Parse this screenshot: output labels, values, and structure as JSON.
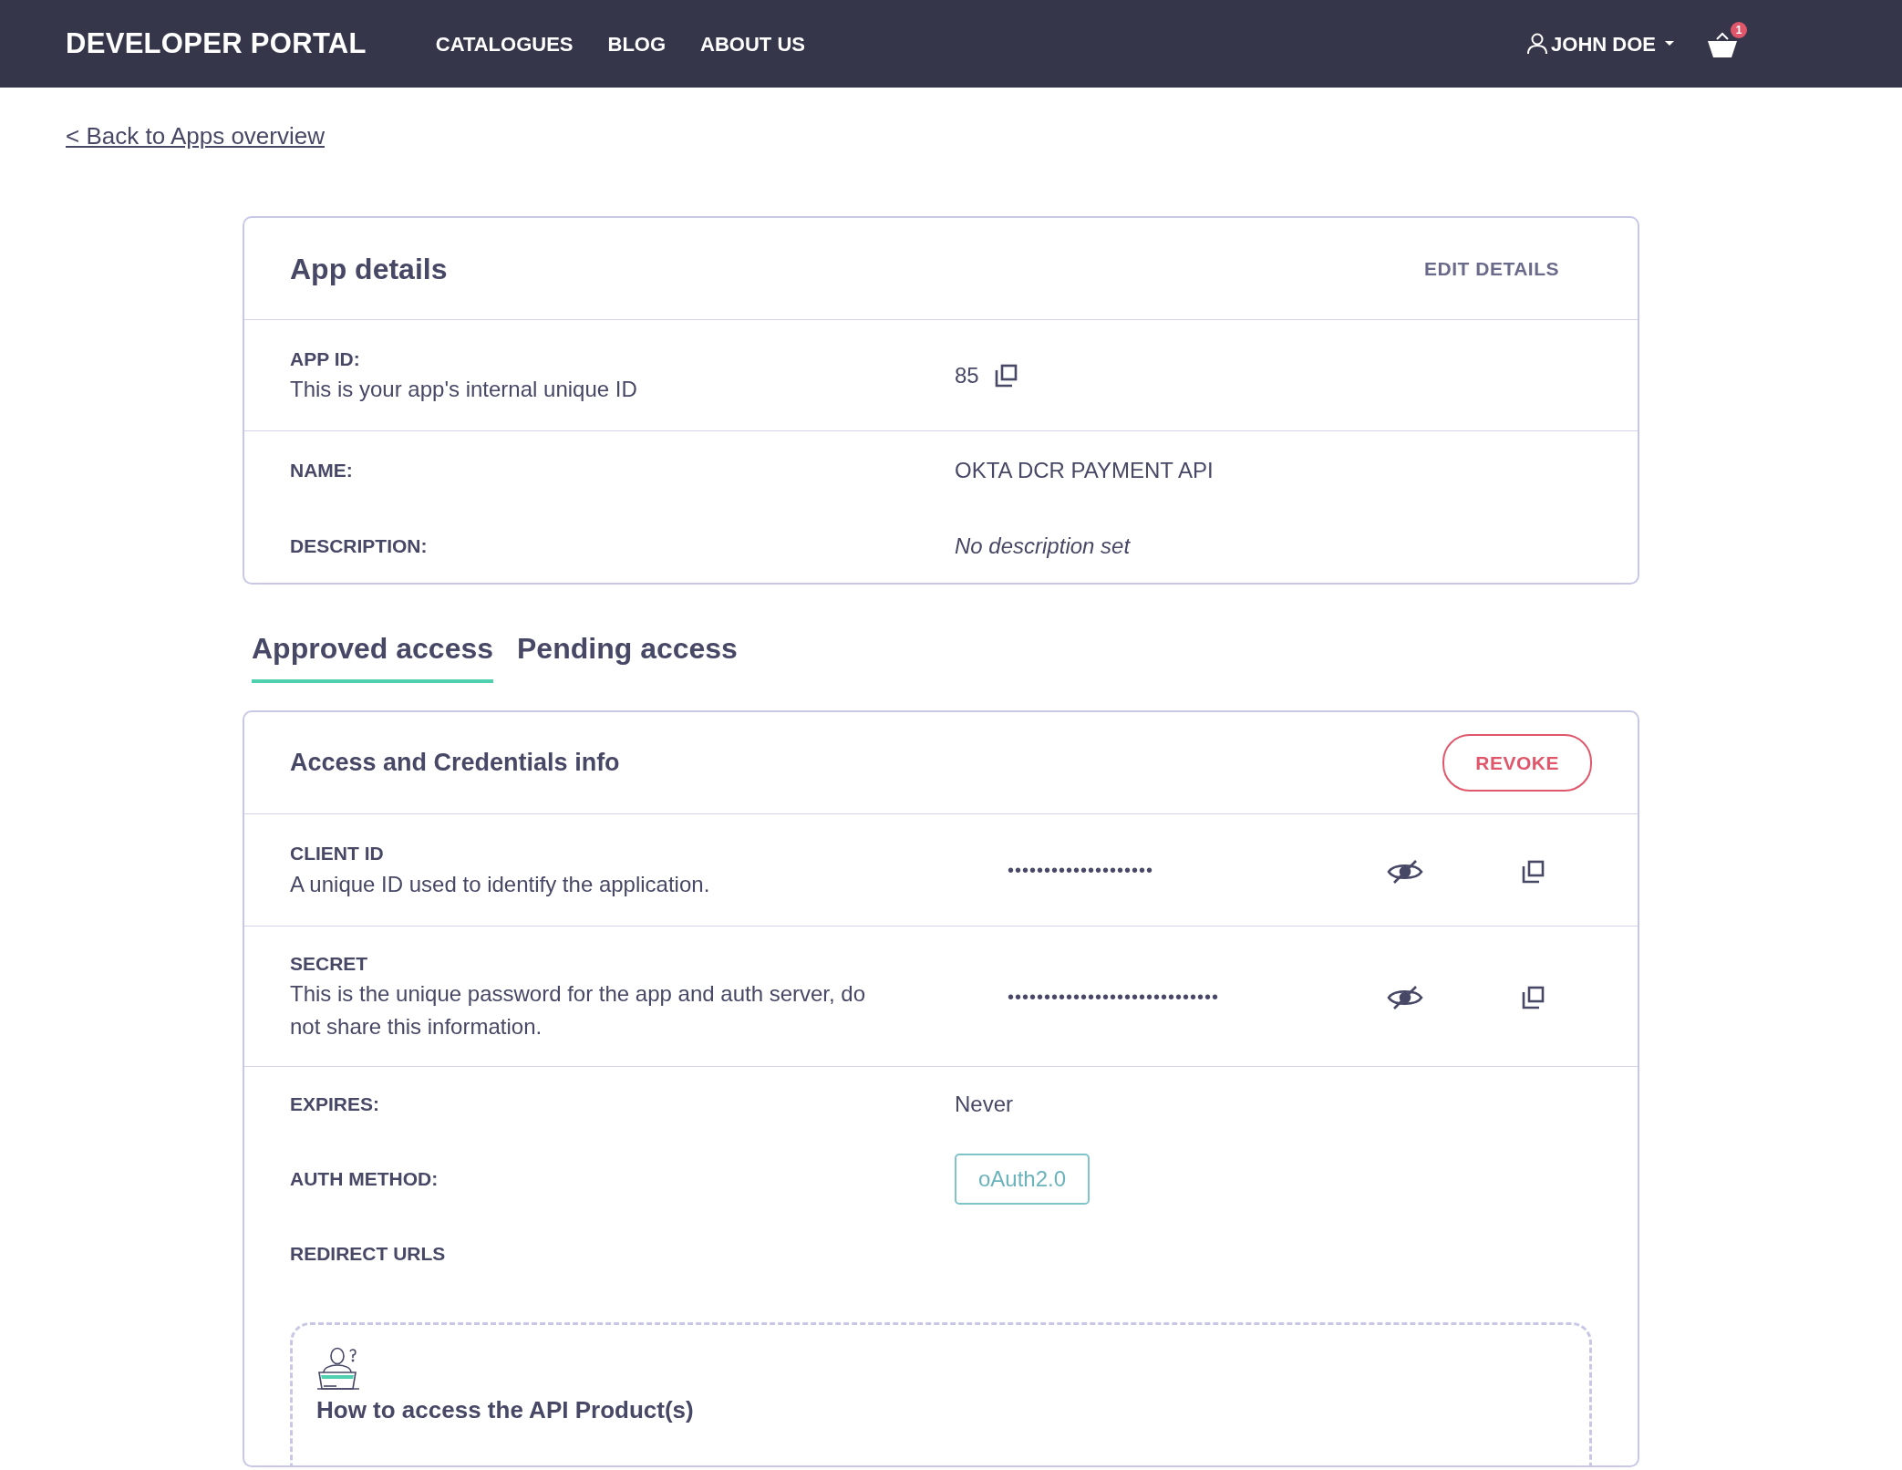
{
  "navbar": {
    "brand": "DEVELOPER PORTAL",
    "links": [
      "CATALOGUES",
      "BLOG",
      "ABOUT US"
    ],
    "user": "JOHN DOE",
    "cart_count": "1"
  },
  "back_link": "< Back to Apps overview",
  "app_details": {
    "title": "App details",
    "edit_button": "EDIT DETAILS",
    "rows": [
      {
        "kind": "described",
        "label": "APP ID:",
        "description": "This is your app's internal unique ID",
        "value": "85"
      },
      {
        "kind": "plain",
        "label": "NAME:",
        "value": "OKTA DCR PAYMENT API"
      },
      {
        "kind": "empty",
        "label": "DESCRIPTION:",
        "value": "No description set"
      }
    ]
  },
  "tabs": [
    {
      "label": "Approved access",
      "selected": true
    },
    {
      "label": "Pending access",
      "selected": false
    }
  ],
  "credentials": {
    "title": "Access and Credentials info",
    "revoke_button": "REVOKE",
    "secrets": [
      {
        "label": "CLIENT ID",
        "description": "A unique ID used to identify the application.",
        "value": "••••••••••••••••••••",
        "masked": true
      },
      {
        "label": "SECRET",
        "description": "This is the unique password for the app and auth server, do not share this information.",
        "value": "•••••••••••••••••••••••••••••",
        "masked": true
      }
    ],
    "fields": [
      {
        "kind": "text",
        "label": "EXPIRES:",
        "value": "Never"
      },
      {
        "kind": "badge",
        "label": "AUTH METHOD:",
        "value": "oAuth2.0"
      },
      {
        "kind": "heading",
        "label": "REDIRECT URLS"
      }
    ],
    "help": {
      "title": "How to access the API Product(s)"
    }
  }
}
